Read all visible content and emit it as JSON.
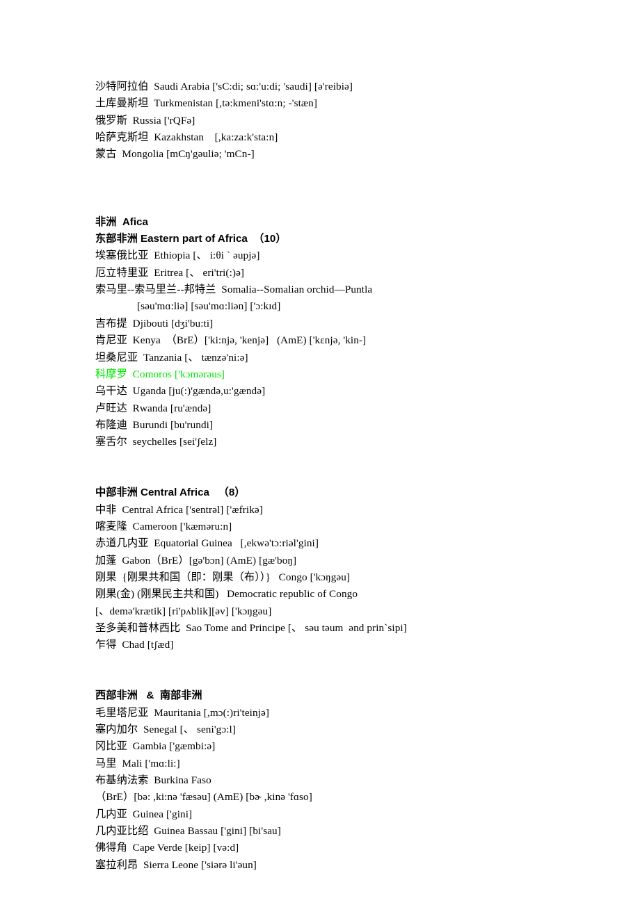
{
  "document": {
    "page_background": "#ffffff",
    "text_color": "#000000",
    "highlight_color": "#00e800"
  },
  "asia_tail": {
    "lines": [
      "沙特阿拉伯  Saudi Arabia ['sC:di; sɑ:'u:di; 'saudi] [ə'reibiə]",
      "土库曼斯坦  Turkmenistan [,tə:kmeni'stɑ:n; -'stæn]",
      "俄罗斯  Russia ['rQFə]",
      "哈萨克斯坦  Kazakhstan    [,ka:za:k'sta:n]",
      "蒙古  Mongolia [mCŋ'gəuliə; 'mCn-]"
    ]
  },
  "africa": {
    "title": "非洲  Afica",
    "sections": [
      {
        "heading": "东部非洲 Eastern part of Africa  （10）",
        "entries": [
          {
            "text": "埃塞俄比亚  Ethiopia [、 i:θi ` əupjə]",
            "style": "normal",
            "indent": false
          },
          {
            "text": "厄立特里亚  Eritrea [、 eri'tri(:)ə]",
            "style": "normal",
            "indent": false
          },
          {
            "text": "索马里--索马里兰--邦特兰  Somalia--Somalian orchid—Puntla",
            "style": "normal",
            "indent": false
          },
          {
            "text": "[səu'mɑ:liə] [səu'mɑ:liən] ['ɔ:kɪd]",
            "style": "normal",
            "indent": true
          },
          {
            "text": "吉布提  Djibouti [dʒi'bu:ti]",
            "style": "normal",
            "indent": false
          },
          {
            "text": "肯尼亚  Kenya  （BrE）['ki:njə, 'kenjə]   (AmE) ['kɛnjə, 'kin-]",
            "style": "normal",
            "indent": false
          },
          {
            "text": "坦桑尼亚  Tanzania [、 tænzə'ni:ə]",
            "style": "normal",
            "indent": false
          },
          {
            "text": "科摩罗  Comoros ['kɔmərəus]",
            "style": "green",
            "indent": false
          },
          {
            "text": "乌干达  Uganda [ju(:)'gændə,u:'gændə]",
            "style": "normal",
            "indent": false
          },
          {
            "text": "卢旺达  Rwanda [ru'ændə]",
            "style": "normal",
            "indent": false
          },
          {
            "text": "布隆迪  Burundi [bu'rundi]",
            "style": "normal",
            "indent": false
          },
          {
            "text": "塞舌尔  seychelles [sei'ʃelz]",
            "style": "normal",
            "indent": false
          }
        ]
      },
      {
        "heading": "中部非洲 Central Africa   （8）",
        "entries": [
          {
            "text": "中非  Central Africa ['sentrəl] ['æfrikə]",
            "style": "normal",
            "indent": false
          },
          {
            "text": "喀麦隆  Cameroon ['kæməru:n]",
            "style": "normal",
            "indent": false
          },
          {
            "text": "赤道几内亚  Equatorial Guinea   [,ekwə'tɔ:riəl'gini]",
            "style": "normal",
            "indent": false
          },
          {
            "text": "加蓬  Gabon（BrE）[gə'bɔn] (AmE) [gæ'boŋ]",
            "style": "normal",
            "indent": false
          },
          {
            "text": "刚果  {刚果共和国（即：刚果（布））}   Congo ['kɔŋgəu]",
            "style": "normal",
            "indent": false
          },
          {
            "text": "刚果(金) (刚果民主共和国)   Democratic republic of Congo",
            "style": "normal",
            "indent": false
          },
          {
            "text": "[、demə'krætik] [ri'pʌblik][əv] ['kɔŋgəu]",
            "style": "normal",
            "indent": false
          },
          {
            "text": "圣多美和普林西比  Sao Tome and Principe [、 səu təum  ənd prin`sipi]",
            "style": "normal",
            "indent": false
          },
          {
            "text": "乍得  Chad [tʃæd]",
            "style": "normal",
            "indent": false
          }
        ]
      },
      {
        "heading": "西部非洲   &  南部非洲",
        "entries": [
          {
            "text": "毛里塔尼亚  Mauritania [,mɔ(:)ri'teinjə]",
            "style": "normal",
            "indent": false
          },
          {
            "text": "塞内加尔  Senegal [、 seni'gɔ:l]",
            "style": "normal",
            "indent": false
          },
          {
            "text": "冈比亚  Gambia ['gæmbi:ə]",
            "style": "normal",
            "indent": false
          },
          {
            "text": "马里  Mali ['mɑ:li:]",
            "style": "normal",
            "indent": false
          },
          {
            "text": "布基纳法索  Burkina Faso",
            "style": "normal",
            "indent": false
          },
          {
            "text": "（BrE）[bə: ,ki:nə 'fæsəu] (AmE) [bɚ ,kinə 'fɑso]",
            "style": "normal",
            "indent": false
          },
          {
            "text": "几内亚  Guinea ['gini]",
            "style": "normal",
            "indent": false
          },
          {
            "text": "几内亚比绍  Guinea Bassau ['gini] [bi'sau]",
            "style": "normal",
            "indent": false
          },
          {
            "text": "佛得角  Cape Verde [keip] [və:d]",
            "style": "normal",
            "indent": false
          },
          {
            "text": "塞拉利昂  Sierra Leone ['siərə li'əun]",
            "style": "normal",
            "indent": false
          }
        ]
      }
    ]
  }
}
